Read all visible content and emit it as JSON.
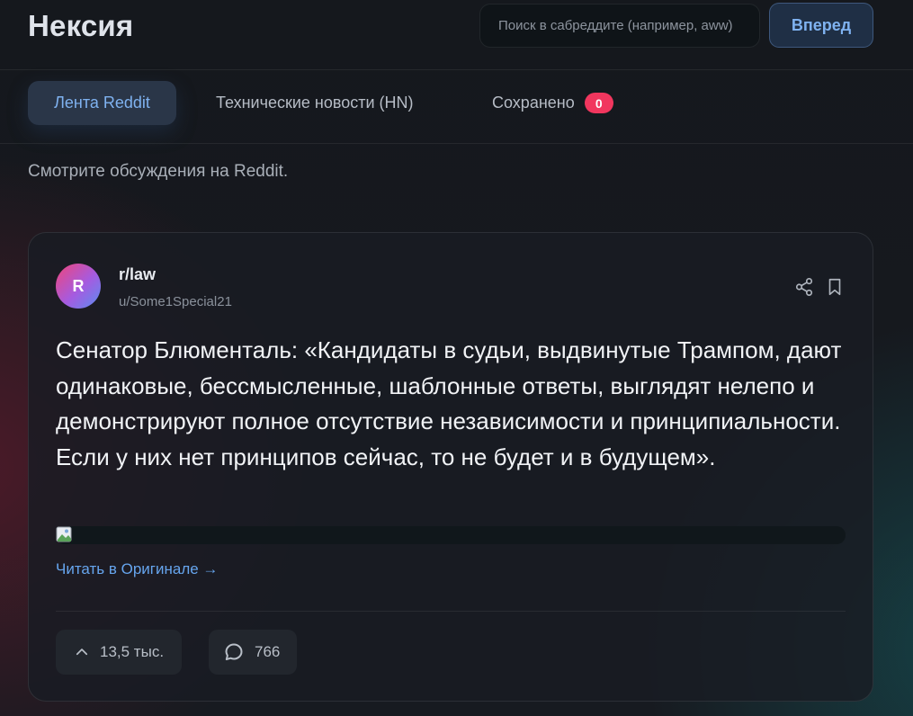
{
  "app": {
    "title": "Нексия"
  },
  "search": {
    "placeholder": "Поиск в сабреддите (например, aww)"
  },
  "header": {
    "go_label": "Вперед"
  },
  "tabs": [
    {
      "label": "Лента Reddit",
      "active": true
    },
    {
      "label": "Технические новости (HN)",
      "active": false
    },
    {
      "label": "Сохранено",
      "active": false,
      "badge": "0"
    }
  ],
  "subtitle": "Смотрите обсуждения на Reddit.",
  "post": {
    "avatar_letter": "R",
    "subreddit": "r/law",
    "author": "u/Some1Special21",
    "title": "Сенатор Блюменталь: «Кандидаты в судьи, выдвинутые Трампом, дают одинаковые, бессмысленные, шаблонные ответы, выглядят нелепо и демонстрируют полное отсутствие независимости и принципиальности. Если у них нет принципов сейчас, то не будет и в будущем».",
    "read_link": "Читать в Оригинале →",
    "votes": "13,5 тыс.",
    "comments": "766",
    "icons": {
      "share": "share-icon",
      "bookmark": "bookmark-icon",
      "upvote": "chevron-up-icon",
      "comment": "comment-bubble-icon",
      "broken_image": "broken-image-icon"
    }
  },
  "colors": {
    "accent": "#7fb2f0",
    "link": "#66a5ee",
    "badge": "#f1365e",
    "card_bg": "#181c23"
  }
}
